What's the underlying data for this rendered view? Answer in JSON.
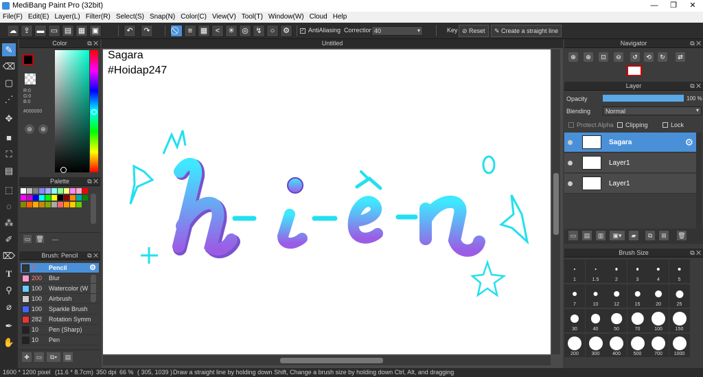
{
  "titlebar": {
    "title": "MediBang Paint Pro (32bit)",
    "min": "—",
    "max": "❐",
    "close": "✕"
  },
  "menu": [
    "File(F)",
    "Edit(E)",
    "Layer(L)",
    "Filter(R)",
    "Select(S)",
    "Snap(N)",
    "Color(C)",
    "View(V)",
    "Tool(T)",
    "Window(W)",
    "Cloud",
    "Help"
  ],
  "toolbar": {
    "antialiasing": "AntiAliasing",
    "correction_label": "Correction",
    "correction_value": "40",
    "key_label": "Key",
    "reset": "Reset",
    "straight_line": "Create a straight line"
  },
  "color_panel": {
    "title": "Color",
    "r": "R:0",
    "g": "G:0",
    "b": "B:0",
    "hex": "#000000",
    "fg_color": "#000000",
    "bg_color": "#ffffff",
    "accent": "#cc0000"
  },
  "palette_panel": {
    "title": "Palette",
    "footer": "---",
    "colors": [
      "#ffffff",
      "#c0c0c0",
      "#808080",
      "#8888ff",
      "#aaaaff",
      "#88ffff",
      "#88ff88",
      "#ffff88",
      "#ff88ff",
      "#ffaacc",
      "#ff0000",
      "#ff00ff",
      "#cc00cc",
      "#0000ff",
      "#00ffff",
      "#00ff00",
      "#ffff00",
      "#000000",
      "#880000",
      "#ff8800",
      "#00aaaa",
      "#008800",
      "#888800",
      "#ff6600",
      "#ffaa00",
      "#cc8800",
      "#88aa00",
      "#aaaaaa",
      "#ff6666",
      "#ff9900",
      "#ffcc00",
      "#66cc00"
    ]
  },
  "brush_panel": {
    "title": "Brush: Pencil",
    "items": [
      {
        "size": "7",
        "name": "Pencil",
        "color": "#333333"
      },
      {
        "size": "200",
        "name": "Blur",
        "color": "#ff99cc"
      },
      {
        "size": "100",
        "name": "Watercolor (W",
        "color": "#66ccff"
      },
      {
        "size": "100",
        "name": "Airbrush",
        "color": "#cccccc"
      },
      {
        "size": "100",
        "name": "Sparkle Brush",
        "color": "#4466ff"
      },
      {
        "size": "282",
        "name": "Rotation Symm",
        "color": "#ee3333"
      },
      {
        "size": "10",
        "name": "Pen (Sharp)",
        "color": "#222222"
      },
      {
        "size": "10",
        "name": "Pen",
        "color": "#222222"
      }
    ]
  },
  "canvas": {
    "tab_title": "Untitled",
    "text_line1": "Sagara",
    "text_line2": "#Hoidap247",
    "art_text": "h-i-ề-n"
  },
  "navigator": {
    "title": "Navigator"
  },
  "layer_panel": {
    "title": "Layer",
    "opacity_label": "Opacity",
    "opacity_value": "100 %",
    "opacity": 1.0,
    "blending_label": "Blending",
    "blending_value": "Normal",
    "protect_alpha": "Protect Alpha",
    "clipping": "Clipping",
    "lock": "Lock",
    "layers": [
      {
        "name": "Sagara",
        "selected": true
      },
      {
        "name": "Layer1",
        "selected": false
      },
      {
        "name": "Layer1",
        "selected": false
      }
    ]
  },
  "brush_size_panel": {
    "title": "Brush Size",
    "sizes": [
      "1",
      "1.5",
      "2",
      "3",
      "4",
      "5",
      "7",
      "10",
      "12",
      "15",
      "20",
      "25",
      "30",
      "40",
      "50",
      "70",
      "100",
      "150",
      "200",
      "300",
      "400",
      "500",
      "700",
      "1000"
    ]
  },
  "statusbar": {
    "dims": "1600 * 1200 pixel",
    "cm": "(11.6 * 8.7cm)",
    "dpi": "350 dpi",
    "zoom": "66 %",
    "coords": "( 305, 1039 )",
    "hint": "Draw a straight line by holding down Shift, Change a brush size by holding down Ctrl, Alt, and dragging"
  }
}
